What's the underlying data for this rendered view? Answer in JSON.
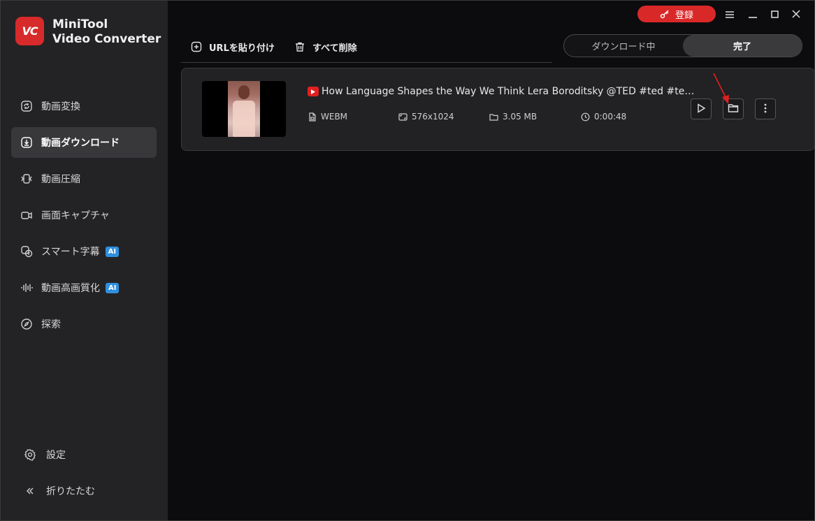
{
  "app": {
    "logo_text": "VC",
    "name_line1": "MiniTool",
    "name_line2": "Video Converter",
    "brand_color": "#d72a2a"
  },
  "titlebar": {
    "register_label": "登録",
    "register_icon": "key-icon",
    "menu_icon": "hamburger-icon",
    "minimize_icon": "minimize-icon",
    "maximize_icon": "maximize-icon",
    "close_icon": "close-icon"
  },
  "sidebar": {
    "items": [
      {
        "label": "動画変換",
        "icon": "convert-icon",
        "active": false
      },
      {
        "label": "動画ダウンロード",
        "icon": "download-icon",
        "active": true
      },
      {
        "label": "動画圧縮",
        "icon": "compress-icon",
        "active": false
      },
      {
        "label": "画面キャプチャ",
        "icon": "camera-icon",
        "active": false
      },
      {
        "label": "スマート字幕",
        "icon": "subtitle-icon",
        "active": false,
        "badge": "AI"
      },
      {
        "label": "動画高画質化",
        "icon": "enhance-icon",
        "active": false,
        "badge": "AI"
      },
      {
        "label": "探索",
        "icon": "compass-icon",
        "active": false
      }
    ],
    "settings_label": "設定",
    "collapse_label": "折りたたむ"
  },
  "toolbar": {
    "paste_url_label": "URLを貼り付け",
    "delete_all_label": "すべて削除",
    "tabs": [
      {
        "label": "ダウンロード中",
        "active": false
      },
      {
        "label": "完了",
        "active": true
      }
    ]
  },
  "download_item": {
    "source_icon": "youtube-icon",
    "title": "How Language Shapes the Way We Think  Lera Boroditsky @TED #ted #tedt...",
    "format": "WEBM",
    "resolution": "576x1024",
    "size": "3.05 MB",
    "duration": "0:00:48",
    "actions": [
      "play-icon",
      "folder-icon",
      "more-icon"
    ]
  },
  "annotation_color": "#e02020"
}
